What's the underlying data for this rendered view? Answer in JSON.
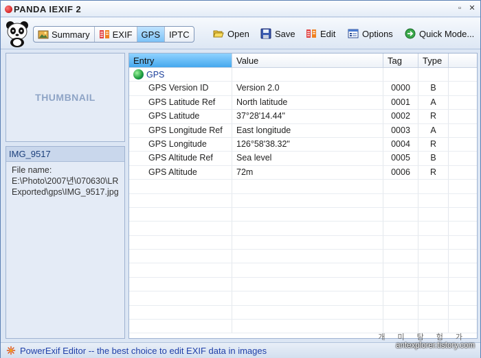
{
  "app": {
    "title": "PANDA IEXIF 2"
  },
  "window_buttons": [
    "▫",
    "✕"
  ],
  "toolbar": {
    "tabs": [
      {
        "label": "Summary",
        "icon": "summary-icon"
      },
      {
        "label": "EXIF",
        "icon": "exif-icon"
      },
      {
        "label": "GPS",
        "icon": "",
        "active": true
      },
      {
        "label": "IPTC",
        "icon": ""
      }
    ],
    "open_label": "Open",
    "save_label": "Save",
    "edit_label": "Edit",
    "options_label": "Options",
    "quick_mode_label": "Quick Mode..."
  },
  "thumbnail": {
    "label": "THUMBNAIL"
  },
  "file_info": {
    "title": "IMG_9517",
    "file_name_label": "File name:",
    "path": "E:\\Photo\\2007년\\070630\\LRExported\\gps\\IMG_9517.jpg"
  },
  "table": {
    "headers": [
      "Entry",
      "Value",
      "Tag",
      "Type"
    ],
    "group": "GPS",
    "rows": [
      {
        "entry": "GPS Version ID",
        "value": "Version 2.0",
        "tag": "0000",
        "type": "B"
      },
      {
        "entry": "GPS Latitude Ref",
        "value": "North latitude",
        "tag": "0001",
        "type": "A"
      },
      {
        "entry": "GPS Latitude",
        "value": "37°28'14.44\"",
        "tag": "0002",
        "type": "R"
      },
      {
        "entry": "GPS Longitude Ref",
        "value": "East longitude",
        "tag": "0003",
        "type": "A"
      },
      {
        "entry": "GPS Longitude",
        "value": "126°58'38.32\"",
        "tag": "0004",
        "type": "R"
      },
      {
        "entry": "GPS Altitude Ref",
        "value": "Sea level",
        "tag": "0005",
        "type": "B"
      },
      {
        "entry": "GPS Altitude",
        "value": "72m",
        "tag": "0006",
        "type": "R"
      }
    ]
  },
  "status": {
    "text": "PowerExif Editor -- the best choice to edit EXIF data in images"
  },
  "watermark": {
    "line1": "개미탐험가",
    "line2": "antexplorer.tistory.com"
  }
}
